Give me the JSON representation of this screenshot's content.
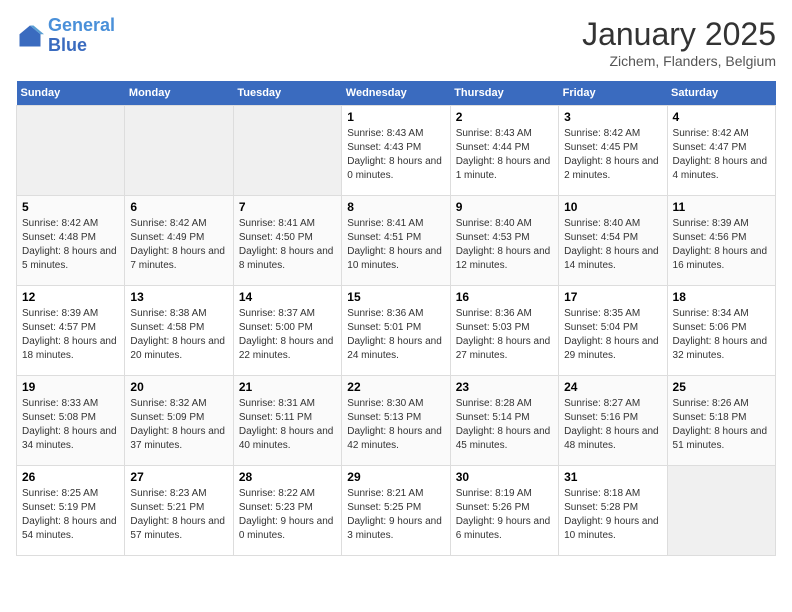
{
  "logo": {
    "line1": "General",
    "line2": "Blue"
  },
  "title": "January 2025",
  "location": "Zichem, Flanders, Belgium",
  "weekdays": [
    "Sunday",
    "Monday",
    "Tuesday",
    "Wednesday",
    "Thursday",
    "Friday",
    "Saturday"
  ],
  "weeks": [
    [
      {
        "day": "",
        "sunrise": "",
        "sunset": "",
        "daylight": ""
      },
      {
        "day": "",
        "sunrise": "",
        "sunset": "",
        "daylight": ""
      },
      {
        "day": "",
        "sunrise": "",
        "sunset": "",
        "daylight": ""
      },
      {
        "day": "1",
        "sunrise": "Sunrise: 8:43 AM",
        "sunset": "Sunset: 4:43 PM",
        "daylight": "Daylight: 8 hours and 0 minutes."
      },
      {
        "day": "2",
        "sunrise": "Sunrise: 8:43 AM",
        "sunset": "Sunset: 4:44 PM",
        "daylight": "Daylight: 8 hours and 1 minute."
      },
      {
        "day": "3",
        "sunrise": "Sunrise: 8:42 AM",
        "sunset": "Sunset: 4:45 PM",
        "daylight": "Daylight: 8 hours and 2 minutes."
      },
      {
        "day": "4",
        "sunrise": "Sunrise: 8:42 AM",
        "sunset": "Sunset: 4:47 PM",
        "daylight": "Daylight: 8 hours and 4 minutes."
      }
    ],
    [
      {
        "day": "5",
        "sunrise": "Sunrise: 8:42 AM",
        "sunset": "Sunset: 4:48 PM",
        "daylight": "Daylight: 8 hours and 5 minutes."
      },
      {
        "day": "6",
        "sunrise": "Sunrise: 8:42 AM",
        "sunset": "Sunset: 4:49 PM",
        "daylight": "Daylight: 8 hours and 7 minutes."
      },
      {
        "day": "7",
        "sunrise": "Sunrise: 8:41 AM",
        "sunset": "Sunset: 4:50 PM",
        "daylight": "Daylight: 8 hours and 8 minutes."
      },
      {
        "day": "8",
        "sunrise": "Sunrise: 8:41 AM",
        "sunset": "Sunset: 4:51 PM",
        "daylight": "Daylight: 8 hours and 10 minutes."
      },
      {
        "day": "9",
        "sunrise": "Sunrise: 8:40 AM",
        "sunset": "Sunset: 4:53 PM",
        "daylight": "Daylight: 8 hours and 12 minutes."
      },
      {
        "day": "10",
        "sunrise": "Sunrise: 8:40 AM",
        "sunset": "Sunset: 4:54 PM",
        "daylight": "Daylight: 8 hours and 14 minutes."
      },
      {
        "day": "11",
        "sunrise": "Sunrise: 8:39 AM",
        "sunset": "Sunset: 4:56 PM",
        "daylight": "Daylight: 8 hours and 16 minutes."
      }
    ],
    [
      {
        "day": "12",
        "sunrise": "Sunrise: 8:39 AM",
        "sunset": "Sunset: 4:57 PM",
        "daylight": "Daylight: 8 hours and 18 minutes."
      },
      {
        "day": "13",
        "sunrise": "Sunrise: 8:38 AM",
        "sunset": "Sunset: 4:58 PM",
        "daylight": "Daylight: 8 hours and 20 minutes."
      },
      {
        "day": "14",
        "sunrise": "Sunrise: 8:37 AM",
        "sunset": "Sunset: 5:00 PM",
        "daylight": "Daylight: 8 hours and 22 minutes."
      },
      {
        "day": "15",
        "sunrise": "Sunrise: 8:36 AM",
        "sunset": "Sunset: 5:01 PM",
        "daylight": "Daylight: 8 hours and 24 minutes."
      },
      {
        "day": "16",
        "sunrise": "Sunrise: 8:36 AM",
        "sunset": "Sunset: 5:03 PM",
        "daylight": "Daylight: 8 hours and 27 minutes."
      },
      {
        "day": "17",
        "sunrise": "Sunrise: 8:35 AM",
        "sunset": "Sunset: 5:04 PM",
        "daylight": "Daylight: 8 hours and 29 minutes."
      },
      {
        "day": "18",
        "sunrise": "Sunrise: 8:34 AM",
        "sunset": "Sunset: 5:06 PM",
        "daylight": "Daylight: 8 hours and 32 minutes."
      }
    ],
    [
      {
        "day": "19",
        "sunrise": "Sunrise: 8:33 AM",
        "sunset": "Sunset: 5:08 PM",
        "daylight": "Daylight: 8 hours and 34 minutes."
      },
      {
        "day": "20",
        "sunrise": "Sunrise: 8:32 AM",
        "sunset": "Sunset: 5:09 PM",
        "daylight": "Daylight: 8 hours and 37 minutes."
      },
      {
        "day": "21",
        "sunrise": "Sunrise: 8:31 AM",
        "sunset": "Sunset: 5:11 PM",
        "daylight": "Daylight: 8 hours and 40 minutes."
      },
      {
        "day": "22",
        "sunrise": "Sunrise: 8:30 AM",
        "sunset": "Sunset: 5:13 PM",
        "daylight": "Daylight: 8 hours and 42 minutes."
      },
      {
        "day": "23",
        "sunrise": "Sunrise: 8:28 AM",
        "sunset": "Sunset: 5:14 PM",
        "daylight": "Daylight: 8 hours and 45 minutes."
      },
      {
        "day": "24",
        "sunrise": "Sunrise: 8:27 AM",
        "sunset": "Sunset: 5:16 PM",
        "daylight": "Daylight: 8 hours and 48 minutes."
      },
      {
        "day": "25",
        "sunrise": "Sunrise: 8:26 AM",
        "sunset": "Sunset: 5:18 PM",
        "daylight": "Daylight: 8 hours and 51 minutes."
      }
    ],
    [
      {
        "day": "26",
        "sunrise": "Sunrise: 8:25 AM",
        "sunset": "Sunset: 5:19 PM",
        "daylight": "Daylight: 8 hours and 54 minutes."
      },
      {
        "day": "27",
        "sunrise": "Sunrise: 8:23 AM",
        "sunset": "Sunset: 5:21 PM",
        "daylight": "Daylight: 8 hours and 57 minutes."
      },
      {
        "day": "28",
        "sunrise": "Sunrise: 8:22 AM",
        "sunset": "Sunset: 5:23 PM",
        "daylight": "Daylight: 9 hours and 0 minutes."
      },
      {
        "day": "29",
        "sunrise": "Sunrise: 8:21 AM",
        "sunset": "Sunset: 5:25 PM",
        "daylight": "Daylight: 9 hours and 3 minutes."
      },
      {
        "day": "30",
        "sunrise": "Sunrise: 8:19 AM",
        "sunset": "Sunset: 5:26 PM",
        "daylight": "Daylight: 9 hours and 6 minutes."
      },
      {
        "day": "31",
        "sunrise": "Sunrise: 8:18 AM",
        "sunset": "Sunset: 5:28 PM",
        "daylight": "Daylight: 9 hours and 10 minutes."
      },
      {
        "day": "",
        "sunrise": "",
        "sunset": "",
        "daylight": ""
      }
    ]
  ]
}
